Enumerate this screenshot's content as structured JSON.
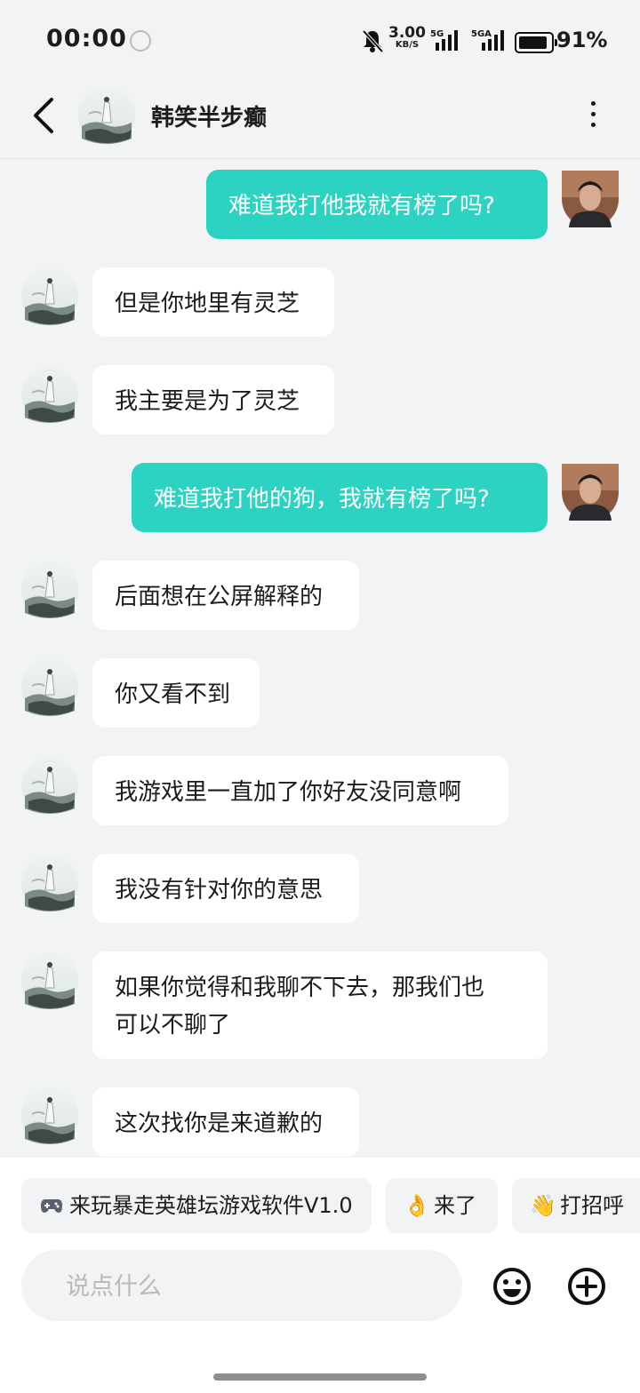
{
  "status_bar": {
    "time": "00:00",
    "net_speed_value": "3.00",
    "net_speed_unit": "KB/S",
    "signal1_label": "5G",
    "signal2_label": "5GA",
    "battery": "91%",
    "icons": [
      "alarm-clock-icon",
      "bell-muted-icon",
      "signal-icon",
      "battery-icon"
    ]
  },
  "header": {
    "contact_name": "韩笑半步癫",
    "icons": [
      "back-arrow-icon",
      "more-vertical-icon"
    ]
  },
  "messages": [
    {
      "side": "out",
      "text": "难道我打他我就有榜了吗?"
    },
    {
      "side": "in",
      "text": "但是你地里有灵芝"
    },
    {
      "side": "in",
      "text": "我主要是为了灵芝"
    },
    {
      "side": "out",
      "text": "难道我打他的狗，我就有榜了吗?"
    },
    {
      "side": "in",
      "text": "后面想在公屏解释的"
    },
    {
      "side": "in",
      "text": "你又看不到"
    },
    {
      "side": "in",
      "text": "我游戏里一直加了你好友没同意啊"
    },
    {
      "side": "in",
      "text": "我没有针对你的意思"
    },
    {
      "side": "in",
      "text": "如果你觉得和我聊不下去，那我们也\n可以不聊了"
    },
    {
      "side": "in",
      "text": "这次找你是来道歉的"
    }
  ],
  "quick_replies": [
    {
      "icon": "game-controller-icon",
      "label": "来玩暴走英雄坛游戏软件V1.0"
    },
    {
      "icon": "ok-hand-icon",
      "label": "来了"
    },
    {
      "icon": "waving-hand-icon",
      "label": "打招呼"
    }
  ],
  "composer": {
    "placeholder": "说点什么",
    "value": "",
    "icons": [
      "emoji-icon",
      "add-icon"
    ]
  },
  "colors": {
    "outgoing_bubble": "#2dd3c2",
    "incoming_bubble": "#ffffff",
    "background": "#f2f3f5"
  }
}
